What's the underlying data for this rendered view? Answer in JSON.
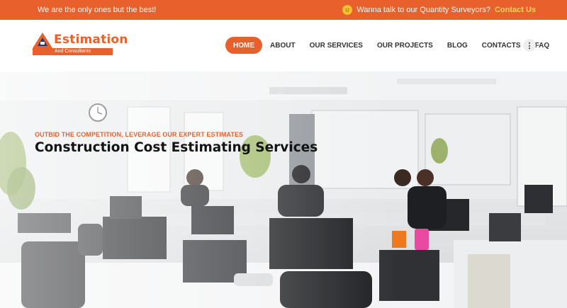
{
  "topbar": {
    "tagline": "We are the only ones but the best!",
    "prompt": "Wanna talk to our Quantity Surveyors?",
    "contact_label": "Contact Us",
    "icon": "smile-icon"
  },
  "logo": {
    "name": "Estimation",
    "subtitle": "And Consultants"
  },
  "nav": {
    "items": [
      {
        "label": "HOME",
        "active": true
      },
      {
        "label": "ABOUT"
      },
      {
        "label": "OUR SERVICES"
      },
      {
        "label": "OUR PROJECTS"
      },
      {
        "label": "BLOG"
      },
      {
        "label": "CONTACTS"
      },
      {
        "label": "FAQ"
      }
    ],
    "more_icon": "more-vertical-icon"
  },
  "hero": {
    "kicker": "OUTBID THE COMPETITION, LEVERAGE OUR EXPERT ESTIMATES",
    "title": "Construction Cost Estimating Services",
    "image": "office-workspace-photo"
  },
  "colors": {
    "accent": "#e8612c",
    "highlight": "#f9d65c"
  }
}
